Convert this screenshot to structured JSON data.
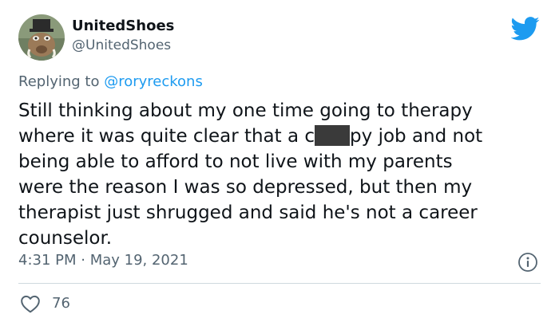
{
  "user": {
    "display_name": "UnitedShoes",
    "handle": "@UnitedShoes"
  },
  "reply": {
    "prefix": "Replying to ",
    "mention": "@roryreckons"
  },
  "tweet": {
    "line1": "Still thinking about my one time going to therapy",
    "line2_before": "where it was quite clear that a c",
    "line2_after": "py job and not",
    "line3": "being able to afford to not live with my parents",
    "line4": "were the reason I was so depressed, but then my",
    "line5": "therapist just shrugged and said he's not a career",
    "line6": "counselor."
  },
  "meta": {
    "timestamp": "4:31 PM · May 19, 2021"
  },
  "engagement": {
    "likes": "76"
  },
  "icons": {
    "brand": "twitter-bird-icon",
    "info": "info-icon",
    "like": "heart-icon"
  },
  "colors": {
    "brand_blue": "#1d9bf0",
    "text_primary": "#0f1419",
    "text_secondary": "#536471",
    "divider": "#cfd9de"
  }
}
